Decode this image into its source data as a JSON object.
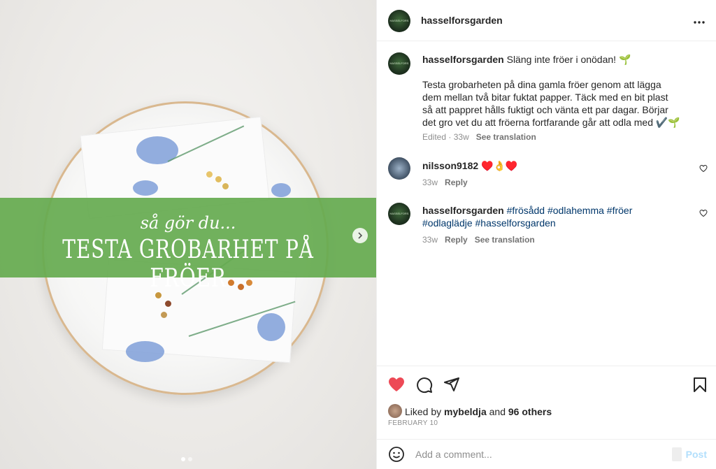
{
  "media": {
    "banner_subtitle": "så gör du...",
    "banner_title": "TESTA GROBARHET PÅ FRÖER",
    "next_icon": "chevron-right-icon",
    "slide_count": 2,
    "current_slide": 1
  },
  "header": {
    "username": "hasselforsgarden",
    "avatar_text": "HASSELFORS",
    "more_icon": "more-horizontal-icon"
  },
  "caption": {
    "username": "hasselforsgarden",
    "first_line": "Släng inte fröer i onödan! 🌱",
    "body": "Testa grobarheten på dina gamla fröer genom att lägga dem mellan två bitar fuktat papper. Täck med en bit plast så att pappret hålls fuktigt och vänta ett par dagar. Börjar det gro vet du att fröerna fortfarande går att odla med ✔️🌱",
    "edited": "Edited",
    "time": "33w",
    "translate": "See translation"
  },
  "comments": [
    {
      "username": "nilsson9182",
      "text": "♥️👌♥️",
      "time": "33w",
      "reply": "Reply"
    },
    {
      "username": "hasselforsgarden",
      "text": "#frösådd #odlahemma #fröer #odlaglädje #hasselforsgarden",
      "time": "33w",
      "reply": "Reply",
      "translate": "See translation"
    }
  ],
  "actions": {
    "like_icon": "heart-filled-icon",
    "comment_icon": "comment-icon",
    "share_icon": "send-icon",
    "save_icon": "bookmark-icon",
    "like_color": "#ed4956"
  },
  "likes": {
    "prefix": "Liked by",
    "user": "mybeldja",
    "and": "and",
    "others": "96 others"
  },
  "date": "FEBRUARY 10",
  "comment_box": {
    "placeholder": "Add a comment...",
    "post_label": "Post",
    "emoji_icon": "emoji-icon"
  }
}
